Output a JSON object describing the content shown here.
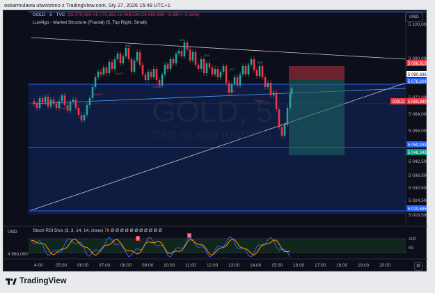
{
  "window": {
    "caption": "oskarmulawa utworzono z TradingView.com, Sty 27, 2026 15:48 UTC+1"
  },
  "header": {
    "symbol": "GOLD · 5 · TVC",
    "open": "O5 079,060",
    "high": "H5 079,353",
    "low": "L5 069,530",
    "close": "C5 069,890",
    "change": "−9,380 (−0,18%)",
    "indicator": "LuxAlgo - Market Structure (Fractal) (5, Top Right, Small)",
    "currency": "USD"
  },
  "watermark": {
    "symbol": "GOLD, 5",
    "description": "CFD na złoto (USD/OZ)"
  },
  "price_axis": {
    "labels": [
      "5 100,000",
      "5 090,000",
      "5 072,000",
      "5 064,000",
      "5 056,000",
      "5 042,500",
      "5 036,500",
      "5 030,500",
      "5 024,500",
      "5 016,500"
    ],
    "badges": [
      {
        "text": "5 086,813",
        "color": "#f23645"
      },
      {
        "text": "5 080,836",
        "color": "#ffffff"
      },
      {
        "text": "5 078,804",
        "color": "#2962ff"
      },
      {
        "text": "5 069,890",
        "color": "#f23645"
      },
      {
        "text": "5 050,043",
        "color": "#2962ff"
      },
      {
        "text": "5 046,343",
        "color": "#089981"
      },
      {
        "text": "5 020,695",
        "color": "#2962ff"
      }
    ],
    "symbol_tag": "GOLD"
  },
  "time_axis": {
    "labels": [
      "4:00",
      "05:00",
      "06:00",
      "07:00",
      "08:00",
      "09:00",
      "10:00",
      "11:00",
      "12:00",
      "13:00",
      "14:00",
      "15:00",
      "16:00",
      "17:00",
      "18:00",
      "19:00",
      "20:00"
    ]
  },
  "structure_labels": [
    "BOS",
    "CHoCH",
    "BOS",
    "CHoCH",
    "CHoCH",
    "CHoCH",
    "BOS",
    "CHoCH",
    "BOS",
    "BOS",
    "CHoCH",
    "BOS",
    "CHoCH",
    "CHoCH"
  ],
  "stoch": {
    "label": "Stoch RSI Divs (3, 3, 14, 14, close)",
    "value_k": "76",
    "value_d": "83",
    "placeholders": "Ø Ø Ø Ø Ø Ø Ø Ø Ø Ø Ø",
    "levels": [
      "100",
      "50"
    ],
    "markers": [
      "R",
      "R"
    ],
    "currency": "USD"
  },
  "volume": {
    "label": "4 560,000"
  },
  "brand": {
    "name": "TradingView"
  },
  "colors": {
    "background": "#0c0f1a",
    "up": "#26a69a",
    "down": "#f23645",
    "accent": "#2962ff",
    "zone": "#0f1e4a"
  }
}
